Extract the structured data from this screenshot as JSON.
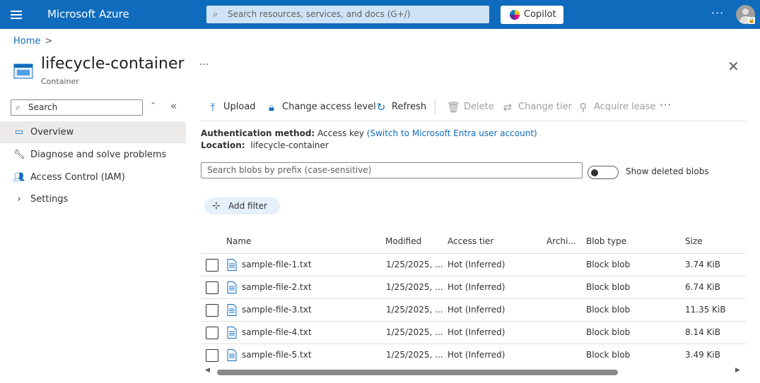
{
  "topbar": {
    "brand": "Microsoft Azure",
    "search_placeholder": "Search resources, services, and docs (G+/)",
    "copilot_label": "Copilot",
    "more": "···"
  },
  "breadcrumb": {
    "home": "Home",
    "separator": ">"
  },
  "header": {
    "title": "lifecycle-container",
    "subtitle": "Container",
    "more": "···",
    "close": "✕"
  },
  "sidebar": {
    "search_placeholder": "Search",
    "items": [
      {
        "label": "Overview",
        "icon": "overview-icon",
        "active": true
      },
      {
        "label": "Diagnose and solve problems",
        "icon": "wrench-icon",
        "active": false
      },
      {
        "label": "Access Control (IAM)",
        "icon": "people-icon",
        "active": false
      },
      {
        "label": "Settings",
        "icon": "chevron-right-icon",
        "active": false
      }
    ]
  },
  "toolbar": {
    "upload": "Upload",
    "change_access": "Change access level",
    "refresh": "Refresh",
    "delete": "Delete",
    "change_tier": "Change tier",
    "acquire_lease": "Acquire lease",
    "more": "···"
  },
  "info": {
    "auth_label": "Authentication method:",
    "auth_value": "Access key",
    "auth_link": "(Switch to Microsoft Entra user account)",
    "location_label": "Location:",
    "location_value": "lifecycle-container"
  },
  "filters": {
    "blob_search_placeholder": "Search blobs by prefix (case-sensitive)",
    "show_deleted_label": "Show deleted blobs",
    "add_filter": "Add filter"
  },
  "table": {
    "columns": [
      "Name",
      "Modified",
      "Access tier",
      "Archi...",
      "Blob type",
      "Size"
    ],
    "rows": [
      {
        "name": "sample-file-1.txt",
        "modified": "1/25/2025, ...",
        "tier": "Hot (Inferred)",
        "archive": "",
        "type": "Block blob",
        "size": "3.74 KiB"
      },
      {
        "name": "sample-file-2.txt",
        "modified": "1/25/2025, ...",
        "tier": "Hot (Inferred)",
        "archive": "",
        "type": "Block blob",
        "size": "6.74 KiB"
      },
      {
        "name": "sample-file-3.txt",
        "modified": "1/25/2025, ...",
        "tier": "Hot (Inferred)",
        "archive": "",
        "type": "Block blob",
        "size": "11.35 KiB"
      },
      {
        "name": "sample-file-4.txt",
        "modified": "1/25/2025, ...",
        "tier": "Hot (Inferred)",
        "archive": "",
        "type": "Block blob",
        "size": "8.14 KiB"
      },
      {
        "name": "sample-file-5.txt",
        "modified": "1/25/2025, ...",
        "tier": "Hot (Inferred)",
        "archive": "",
        "type": "Block blob",
        "size": "3.49 KiB"
      }
    ]
  },
  "colors": {
    "brand_blue": "#0f6cbd",
    "active_nav_bg": "#edebe9",
    "disabled_text": "#a19f9d"
  }
}
